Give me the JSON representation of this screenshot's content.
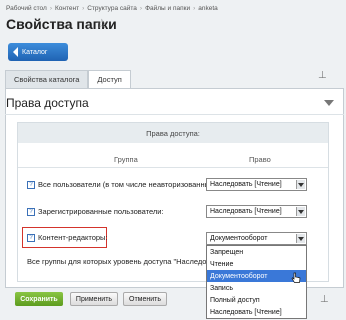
{
  "breadcrumbs": [
    "Рабочий стол",
    "Контент",
    "Структура сайта",
    "Файлы и папки",
    "anketa"
  ],
  "breadcrumb_separator": "›",
  "page": {
    "title": "Свойства папки",
    "star": "☆"
  },
  "back_button": {
    "label": "Каталог"
  },
  "tabs": [
    {
      "label": "Свойства каталога"
    },
    {
      "label": "Доступ"
    }
  ],
  "pin_glyph": "⊥",
  "section": {
    "title": "Права доступа"
  },
  "access": {
    "header": "Права доступа:",
    "col_group": "Группа",
    "col_right": "Право",
    "question_glyph": "?",
    "rows": [
      {
        "label": "Все пользователи (в том числе неавторизованные):",
        "value": "Наследовать [Чтение]"
      },
      {
        "label": "Зарегистрированные пользователи:",
        "value": "Наследовать [Чтение]"
      },
      {
        "label": "Контент-редакторы:",
        "value": "Документооборот"
      }
    ],
    "inherit_label": "Все группы для которых уровень доступа \"Наследовать\":"
  },
  "dropdown": {
    "options": [
      "Запрещен",
      "Чтение",
      "Документооборот",
      "Запись",
      "Полный доступ",
      "Наследовать [Чтение]"
    ],
    "selected_index": 2
  },
  "buttons": {
    "save": "Сохранить",
    "apply": "Применить",
    "cancel": "Отменить"
  }
}
